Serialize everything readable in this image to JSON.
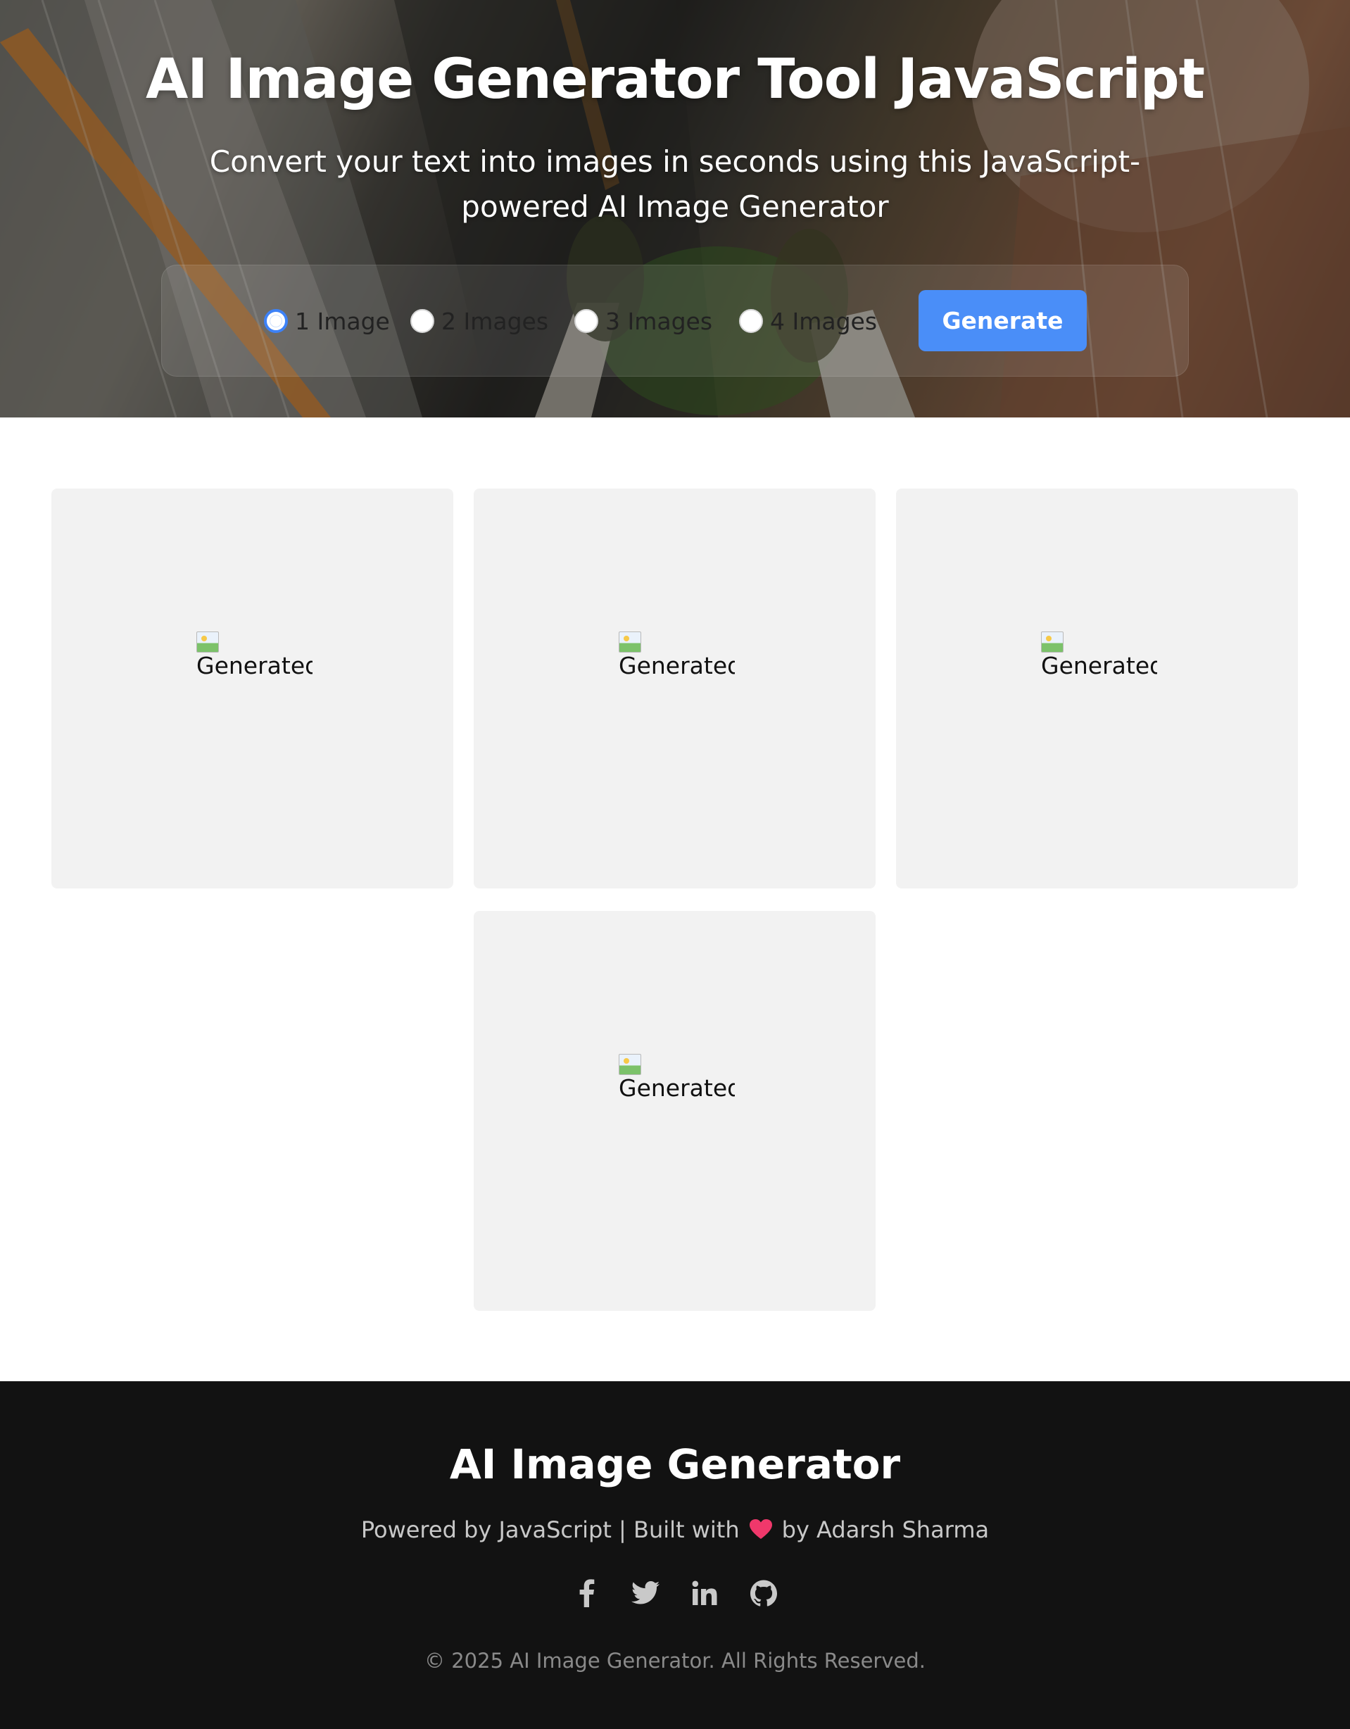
{
  "hero": {
    "title": "AI Image Generator Tool JavaScript",
    "subtitle": "Convert your text into images in seconds using this JavaScript-powered AI Image Generator",
    "options": [
      {
        "label": "1 Image",
        "checked": true
      },
      {
        "label": "2 Images",
        "checked": false
      },
      {
        "label": "3 Images",
        "checked": false
      },
      {
        "label": "4 Images",
        "checked": false
      }
    ],
    "generate_label": "Generate"
  },
  "gallery": {
    "images": [
      {
        "alt": "Generated Image"
      },
      {
        "alt": "Generated Image"
      },
      {
        "alt": "Generated Image"
      },
      {
        "alt": "Generated Image"
      }
    ]
  },
  "footer": {
    "title": "AI Image Generator",
    "powered_prefix": "Powered by JavaScript | Built with",
    "powered_suffix": "by Adarsh Sharma",
    "social": [
      "facebook-icon",
      "twitter-icon",
      "linkedin-icon",
      "github-icon"
    ],
    "copyright": "© 2025 AI Image Generator. All Rights Reserved."
  },
  "colors": {
    "accent": "#4a8ef8",
    "radio_checked": "#3d82f7",
    "card_bg": "#f2f2f2",
    "footer_bg": "#121212",
    "heart": "#f0386b"
  }
}
